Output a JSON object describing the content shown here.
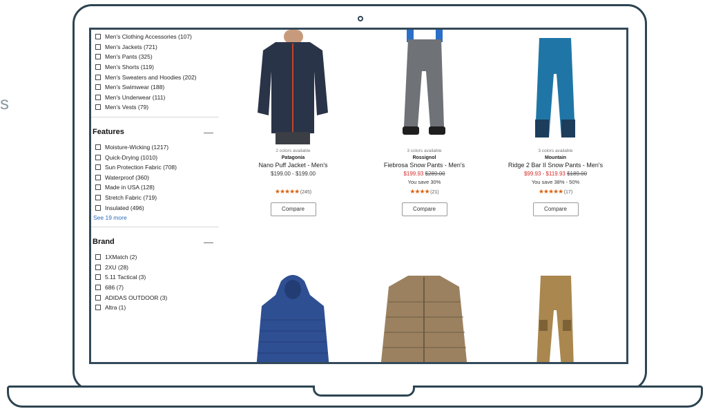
{
  "side_letter": "s",
  "sidebar": {
    "top_filters": [
      "Men's Clothing Accessories (107)",
      "Men's Jackets (721)",
      "Men's Pants (325)",
      "Men's Shorts (119)",
      "Men's Sweaters and Hoodies (202)",
      "Men's Swimwear (188)",
      "Men's Underwear (111)",
      "Men's Vests (79)"
    ],
    "features": {
      "title": "Features",
      "collapse_symbol": "—",
      "items": [
        "Moisture-Wicking (1217)",
        "Quick-Drying (1010)",
        "Sun Protection Fabric (708)",
        "Waterproof (360)",
        "Made in USA (128)",
        "Stretch Fabric (719)",
        "Insulated (496)"
      ],
      "see_more": "See 19 more"
    },
    "brand": {
      "title": "Brand",
      "collapse_symbol": "—",
      "items": [
        "1XMatch (2)",
        "2XU (28)",
        "5.11 Tactical (3)",
        "686 (7)",
        "ADIDAS OUTDOOR (3)",
        "Altra (1)"
      ]
    }
  },
  "products": [
    {
      "colors_note": "2 colors available",
      "brand": "Patagonia",
      "title": "Nano Puff Jacket - Men's",
      "price_regular": "$199.00 - $199.00",
      "price_sale": "",
      "price_orig": "",
      "save": "",
      "stars": "★★★★★",
      "reviews": "(245)",
      "compare": "Compare",
      "product_color": "#2a3448",
      "accent_color": "#c2452a"
    },
    {
      "colors_note": "3 colors available",
      "brand": "Rossignol",
      "title": "Fiebrosa Snow Pants - Men's",
      "price_regular": "",
      "price_sale": "$199.93",
      "price_orig": "$289.00",
      "save": "You save 30%",
      "stars": "★★★★",
      "reviews": "(21)",
      "compare": "Compare",
      "product_color": "#6f7276",
      "accent_color": "#2a6fc9"
    },
    {
      "colors_note": "3 colors available",
      "brand": "Mountain",
      "title": "Ridge 2 Bar II Snow Pants - Men's",
      "price_regular": "",
      "price_sale": "$99.93 - $119.93",
      "price_orig": "$189.00",
      "save": "You save 38% - 50%",
      "stars": "★★★★★",
      "reviews": "(17)",
      "compare": "Compare",
      "product_color": "#1f76a6",
      "accent_color": "#1d3d5c"
    },
    {
      "product_color": "#2f4f93",
      "accent_color": "#233c74"
    },
    {
      "product_color": "#9c8160",
      "accent_color": "#6d5a42"
    },
    {
      "product_color": "#a9874f",
      "accent_color": "#7d6236"
    }
  ]
}
